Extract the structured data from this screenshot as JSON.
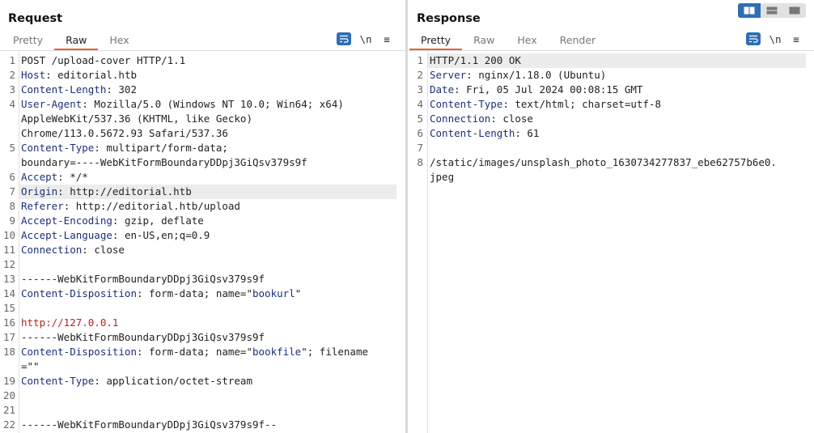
{
  "request": {
    "title": "Request",
    "tabs": [
      "Pretty",
      "Raw",
      "Hex"
    ],
    "active_tab": "Raw",
    "tools": {
      "newline_label": "\\n",
      "menu_label": "≡"
    },
    "lines": [
      {
        "n": "1",
        "parts": [
          {
            "t": "POST /upload-cover HTTP/1.1",
            "c": "pl"
          }
        ]
      },
      {
        "n": "2",
        "parts": [
          {
            "t": "Host",
            "c": "hk"
          },
          {
            "t": ": editorial.htb",
            "c": "hv"
          }
        ]
      },
      {
        "n": "3",
        "parts": [
          {
            "t": "Content-Length",
            "c": "hk"
          },
          {
            "t": ": 302",
            "c": "hv"
          }
        ]
      },
      {
        "n": "4",
        "parts": [
          {
            "t": "User-Agent",
            "c": "hk"
          },
          {
            "t": ": Mozilla/5.0 (Windows NT 10.0; Win64; x64)",
            "c": "hv"
          }
        ]
      },
      {
        "n": "",
        "parts": [
          {
            "t": "AppleWebKit/537.36 (KHTML, like Gecko)",
            "c": "hv"
          }
        ]
      },
      {
        "n": "",
        "parts": [
          {
            "t": "Chrome/113.0.5672.93 Safari/537.36",
            "c": "hv"
          }
        ]
      },
      {
        "n": "5",
        "parts": [
          {
            "t": "Content-Type",
            "c": "hk"
          },
          {
            "t": ": multipart/form-data;",
            "c": "hv"
          }
        ]
      },
      {
        "n": "",
        "parts": [
          {
            "t": "boundary=----WebKitFormBoundaryDDpj3GiQsv379s9f",
            "c": "hv"
          }
        ]
      },
      {
        "n": "6",
        "parts": [
          {
            "t": "Accept",
            "c": "hk"
          },
          {
            "t": ": */*",
            "c": "hv"
          }
        ]
      },
      {
        "n": "7",
        "parts": [
          {
            "t": "Origin",
            "c": "hk"
          },
          {
            "t": ": http://editorial.htb",
            "c": "hv"
          }
        ],
        "hl": true
      },
      {
        "n": "8",
        "parts": [
          {
            "t": "Referer",
            "c": "hk"
          },
          {
            "t": ": http://editorial.htb/upload",
            "c": "hv"
          }
        ]
      },
      {
        "n": "9",
        "parts": [
          {
            "t": "Accept-Encoding",
            "c": "hk"
          },
          {
            "t": ": gzip, deflate",
            "c": "hv"
          }
        ]
      },
      {
        "n": "10",
        "parts": [
          {
            "t": "Accept-Language",
            "c": "hk"
          },
          {
            "t": ": en-US,en;q=0.9",
            "c": "hv"
          }
        ]
      },
      {
        "n": "11",
        "parts": [
          {
            "t": "Connection",
            "c": "hk"
          },
          {
            "t": ": close",
            "c": "hv"
          }
        ]
      },
      {
        "n": "12",
        "parts": []
      },
      {
        "n": "13",
        "parts": [
          {
            "t": "------WebKitFormBoundaryDDpj3GiQsv379s9f",
            "c": "pl"
          }
        ]
      },
      {
        "n": "14",
        "parts": [
          {
            "t": "Content-Disposition",
            "c": "hk"
          },
          {
            "t": ": form-data; name=\"",
            "c": "hv"
          },
          {
            "t": "bookurl",
            "c": "qs"
          },
          {
            "t": "\"",
            "c": "hv"
          }
        ]
      },
      {
        "n": "15",
        "parts": []
      },
      {
        "n": "16",
        "parts": [
          {
            "t": "http://127.0.0.1",
            "c": "url"
          }
        ]
      },
      {
        "n": "17",
        "parts": [
          {
            "t": "------WebKitFormBoundaryDDpj3GiQsv379s9f",
            "c": "pl"
          }
        ]
      },
      {
        "n": "18",
        "parts": [
          {
            "t": "Content-Disposition",
            "c": "hk"
          },
          {
            "t": ": form-data; name=\"",
            "c": "hv"
          },
          {
            "t": "bookfile",
            "c": "qs"
          },
          {
            "t": "\"; filename",
            "c": "hv"
          }
        ]
      },
      {
        "n": "",
        "parts": [
          {
            "t": "=\"\"",
            "c": "hv"
          }
        ]
      },
      {
        "n": "19",
        "parts": [
          {
            "t": "Content-Type",
            "c": "hk"
          },
          {
            "t": ": application/octet-stream",
            "c": "hv"
          }
        ]
      },
      {
        "n": "20",
        "parts": []
      },
      {
        "n": "21",
        "parts": []
      },
      {
        "n": "22",
        "parts": [
          {
            "t": "------WebKitFormBoundaryDDpj3GiQsv379s9f--",
            "c": "pl"
          }
        ]
      }
    ]
  },
  "response": {
    "title": "Response",
    "tabs": [
      "Pretty",
      "Raw",
      "Hex",
      "Render"
    ],
    "active_tab": "Pretty",
    "tools": {
      "newline_label": "\\n",
      "menu_label": "≡"
    },
    "lines": [
      {
        "n": "1",
        "parts": [
          {
            "t": "HTTP/1.1 200 OK",
            "c": "pl"
          }
        ],
        "hl": true
      },
      {
        "n": "2",
        "parts": [
          {
            "t": "Server",
            "c": "hk"
          },
          {
            "t": ": nginx/1.18.0 (Ubuntu)",
            "c": "hv"
          }
        ]
      },
      {
        "n": "3",
        "parts": [
          {
            "t": "Date",
            "c": "hk"
          },
          {
            "t": ": Fri, 05 Jul 2024 00:08:15 GMT",
            "c": "hv"
          }
        ]
      },
      {
        "n": "4",
        "parts": [
          {
            "t": "Content-Type",
            "c": "hk"
          },
          {
            "t": ": text/html; charset=utf-8",
            "c": "hv"
          }
        ]
      },
      {
        "n": "5",
        "parts": [
          {
            "t": "Connection",
            "c": "hk"
          },
          {
            "t": ": close",
            "c": "hv"
          }
        ]
      },
      {
        "n": "6",
        "parts": [
          {
            "t": "Content-Length",
            "c": "hk"
          },
          {
            "t": ": 61",
            "c": "hv"
          }
        ]
      },
      {
        "n": "7",
        "parts": []
      },
      {
        "n": "8",
        "parts": [
          {
            "t": "/static/images/unsplash_photo_1630734277837_ebe62757b6e0.",
            "c": "pl"
          }
        ]
      },
      {
        "n": "",
        "parts": [
          {
            "t": "jpeg",
            "c": "pl"
          }
        ]
      }
    ]
  },
  "layout_toggle": [
    "side-by-side",
    "stacked",
    "single"
  ],
  "colors": {
    "accent": "#e8623c",
    "button_blue": "#2f6db5",
    "header_key": "#1d2f7a",
    "url_red": "#b3261e"
  }
}
